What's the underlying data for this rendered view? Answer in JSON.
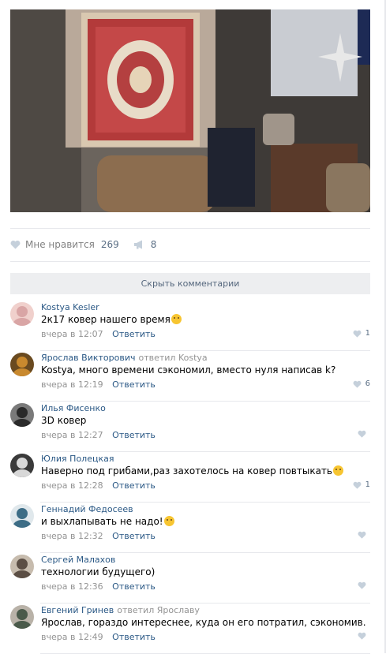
{
  "post": {
    "photo_alt": "photo",
    "likes_label": "Мне нравится",
    "likes_count": "269",
    "shares_count": "8"
  },
  "comments_toggle": "Скрыть комментарии",
  "comments": [
    {
      "author": "Kostya Kesler",
      "replied": "",
      "text": "2к17 ковер нашего время",
      "time": "вчера в 12:07",
      "reply": "Ответить",
      "likes": "1",
      "emoji": true
    },
    {
      "author": "Ярослав Викторович",
      "replied": "ответил Kostya",
      "text": "Kostya, много времени сэкономил, вместо нуля написав k?",
      "time": "вчера в 12:19",
      "reply": "Ответить",
      "likes": "6",
      "emoji": false
    },
    {
      "author": "Илья Фисенко",
      "replied": "",
      "text": "3D ковер",
      "time": "вчера в 12:27",
      "reply": "Ответить",
      "likes": "",
      "emoji": false
    },
    {
      "author": "Юлия Полецкая",
      "replied": "",
      "text": "Наверно под грибами,раз захотелось на ковер повтыкать",
      "time": "вчера в 12:28",
      "reply": "Ответить",
      "likes": "1",
      "emoji": true
    },
    {
      "author": "Геннадий Федосеев",
      "replied": "",
      "text": "и выхлапывать не надо!",
      "time": "вчера в 12:32",
      "reply": "Ответить",
      "likes": "",
      "emoji": true
    },
    {
      "author": "Сергей Малахов",
      "replied": "",
      "text": "технологии будущего)",
      "time": "вчера в 12:36",
      "reply": "Ответить",
      "likes": "",
      "emoji": false
    },
    {
      "author": "Евгений Гринев",
      "replied": "ответил Ярославу",
      "text": "Ярослав, гораздо интереснее, куда он его потратил, сэкономив.",
      "time": "вчера в 12:49",
      "reply": "Ответить",
      "likes": "",
      "emoji": false
    }
  ],
  "colors": {
    "link": "#2a5885",
    "muted": "#939393",
    "like_icon": "#c5d0db"
  }
}
